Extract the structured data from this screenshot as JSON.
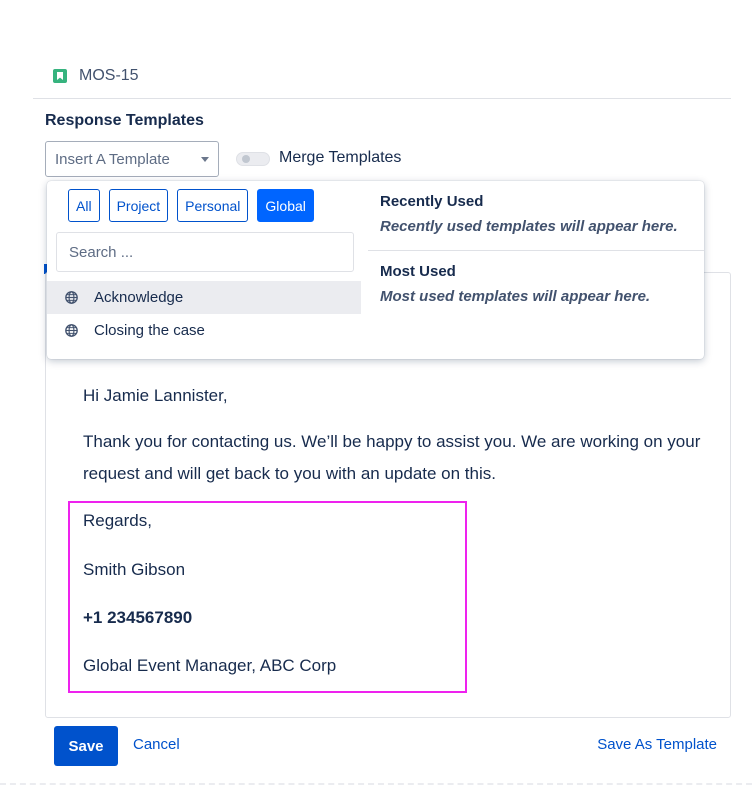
{
  "issue": {
    "key": "MOS-15",
    "icon": "story-bookmark-icon"
  },
  "section_title": "Response Templates",
  "insert_template": {
    "label": "Insert A Template"
  },
  "merge_toggle": {
    "label": "Merge Templates",
    "checked": false
  },
  "dropdown": {
    "filters": [
      {
        "label": "All",
        "active": false
      },
      {
        "label": "Project",
        "active": false
      },
      {
        "label": "Personal",
        "active": false
      },
      {
        "label": "Global",
        "active": true
      }
    ],
    "search_placeholder": "Search ...",
    "templates": [
      {
        "label": "Acknowledge",
        "icon": "globe-icon",
        "highlighted": true
      },
      {
        "label": "Closing the case",
        "icon": "globe-icon",
        "highlighted": false
      }
    ],
    "recently_used": {
      "title": "Recently Used",
      "description": "Recently used templates will appear here."
    },
    "most_used": {
      "title": "Most Used",
      "description": "Most used templates will appear here."
    }
  },
  "email": {
    "greeting": "Hi Jamie Lannister,",
    "body": "Thank you for contacting us. We’ll be happy to assist you. We are working on your request and will get back to you with an update on this.",
    "signature": {
      "regards": "Regards,",
      "name": "Smith Gibson",
      "phone": "+1 234567890",
      "role": "Global Event Manager, ABC Corp"
    }
  },
  "actions": {
    "save": "Save",
    "cancel": "Cancel",
    "save_as_template": "Save As Template"
  },
  "colors": {
    "primary": "#0052cc",
    "active_filter": "#0065ff",
    "highlight_border": "#ee22ee",
    "issue_icon": "#36b37e"
  }
}
